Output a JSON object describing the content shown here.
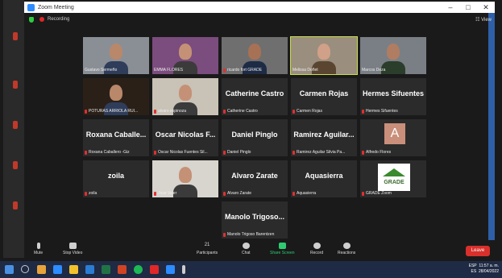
{
  "window": {
    "title": "Zoom Meeting",
    "controls": [
      "–",
      "□",
      "✕"
    ]
  },
  "status": {
    "recording_label": "Recording",
    "view_label": "View"
  },
  "tiles": [
    {
      "display": "",
      "name": "Gustavo Sermeño",
      "muted": false,
      "video": true
    },
    {
      "display": "",
      "name": "EMMA FLORES",
      "muted": false,
      "video": true
    },
    {
      "display": "",
      "name": "ricardo fort GRADE",
      "muted": true,
      "video": true
    },
    {
      "display": "",
      "name": "Melissa Doñet",
      "muted": false,
      "video": true,
      "active": true
    },
    {
      "display": "",
      "name": "Marcos Deza",
      "muted": false,
      "video": true
    },
    {
      "display": "",
      "name": "POTURAS ARRIOLA RUI...",
      "muted": true,
      "video": true
    },
    {
      "display": "",
      "name": "alvaro espinoza",
      "muted": true,
      "video": true
    },
    {
      "display": "Catherine Castro",
      "name": "Catherine Castro",
      "muted": true,
      "video": false
    },
    {
      "display": "Carmen Rojas",
      "name": "Carmen Rojas",
      "muted": true,
      "video": false
    },
    {
      "display": "Hermes Sifuentes",
      "name": "Hermes Sifuentes",
      "muted": true,
      "video": false
    },
    {
      "display": "Roxana Caballe...",
      "name": "Roxana Caballero -Giz",
      "muted": true,
      "video": false
    },
    {
      "display": "Oscar Nicolas F...",
      "name": "Oscar Nicolas Fuentes Sil...",
      "muted": true,
      "video": false
    },
    {
      "display": "Daniel Pinglo",
      "name": "Daniel Pinglo",
      "muted": true,
      "video": false
    },
    {
      "display": "Ramirez Aguilar...",
      "name": "Ramirez Aguilar Silvia Pa...",
      "muted": true,
      "video": false
    },
    {
      "display": "A",
      "name": "Alfredo Flores",
      "muted": true,
      "video": false,
      "avatar": true
    },
    {
      "display": "zoila",
      "name": "zoila",
      "muted": true,
      "video": false
    },
    {
      "display": "",
      "name": "Jose Valer",
      "muted": true,
      "video": true
    },
    {
      "display": "Alvaro Zarate",
      "name": "Alvaro Zarate",
      "muted": true,
      "video": false
    },
    {
      "display": "Aquasierra",
      "name": "Aquasierra",
      "muted": true,
      "video": false
    },
    {
      "display": "GRADE",
      "name": "GRADE Zoom",
      "muted": true,
      "video": false,
      "logo": true
    },
    {
      "display": "Manolo Trigoso...",
      "name": "Manolo Trigoso Barentzen",
      "muted": true,
      "video": false
    }
  ],
  "toolbar": {
    "mute": "Mute",
    "stop_video": "Stop Video",
    "participants": "Participants",
    "participants_count": "21",
    "chat": "Chat",
    "share_screen": "Share Screen",
    "record": "Record",
    "reactions": "Reactions",
    "leave": "Leave"
  },
  "taskbar": {
    "lang": "ESP",
    "lang2": "ES",
    "time": "11:57 a. m.",
    "date": "28/04/2022"
  },
  "colors": {
    "accent": "#2d8cff",
    "leave": "#d9302b",
    "active_border": "#c8e04a",
    "share": "#2ecc71"
  }
}
